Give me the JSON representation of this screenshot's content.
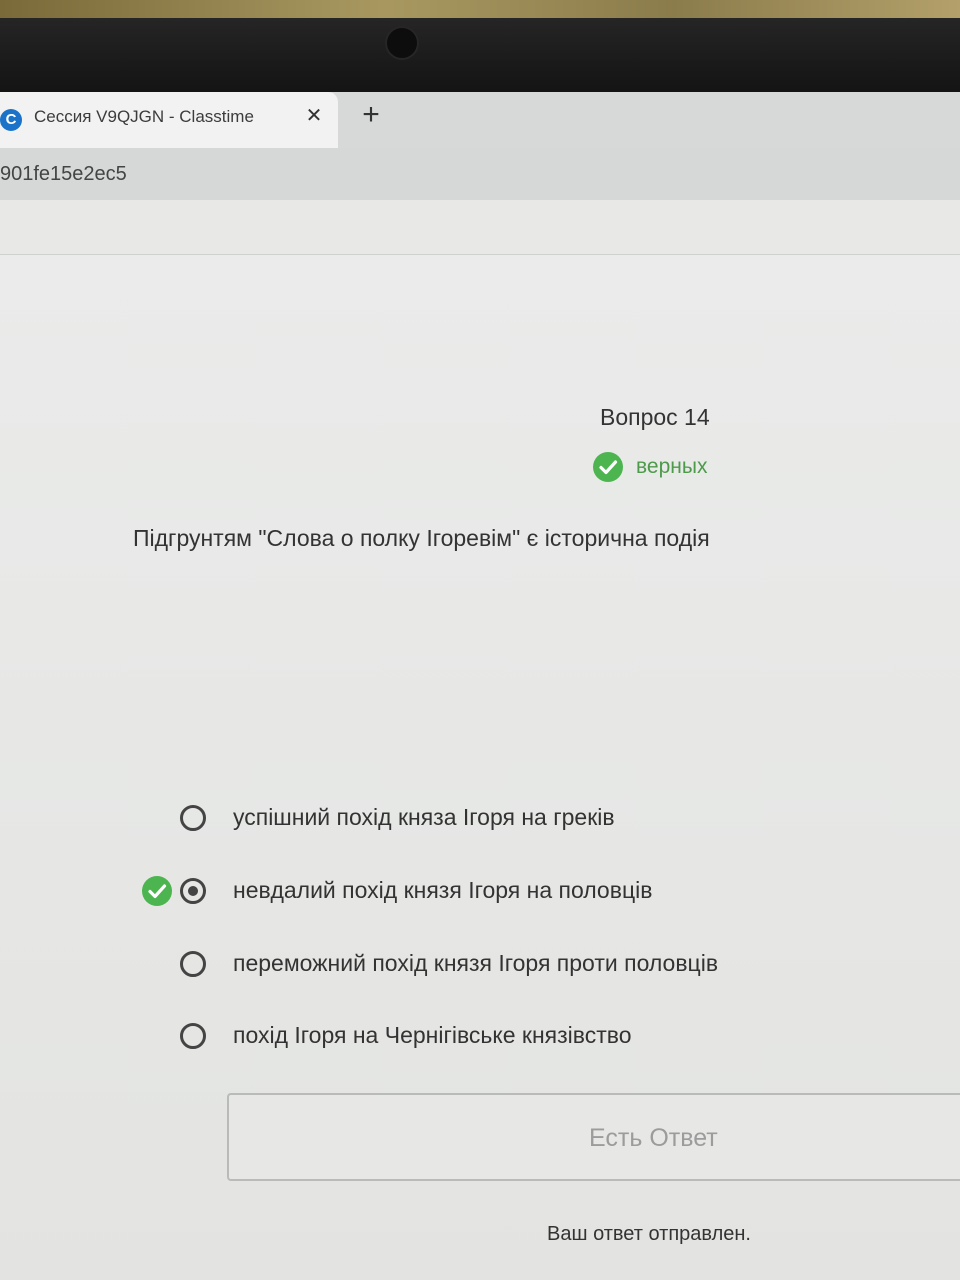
{
  "browser": {
    "tab_title": "Сессия V9QJGN - Classtime",
    "tab_favicon_letter": "C",
    "close_glyph": "✕",
    "new_tab_glyph": "+",
    "url": "901fe15e2ec5"
  },
  "question": {
    "title": "Вопрос 14",
    "status": "верных",
    "text": "Підгрунтям \"Слова о полку Ігоревім\" є історична подія"
  },
  "options": [
    {
      "label": "успішний похід княза Ігоря на греків",
      "selected": false,
      "correct": false
    },
    {
      "label": "невдалий похід князя Ігоря на половців",
      "selected": true,
      "correct": true
    },
    {
      "label": "переможний похід князя Ігоря проти половців",
      "selected": false,
      "correct": false
    },
    {
      "label": "похід Ігоря на Чернігівське князівство",
      "selected": false,
      "correct": false
    }
  ],
  "submit": {
    "label": "Есть Ответ"
  },
  "sent_message": "Ваш ответ отправлен.",
  "colors": {
    "success": "#4cb550",
    "favicon": "#1a73c8",
    "text": "#333333"
  },
  "icons": {
    "status": "check-circle-icon",
    "favicon": "classtime-favicon-icon",
    "close": "close-icon",
    "new_tab": "plus-icon"
  }
}
